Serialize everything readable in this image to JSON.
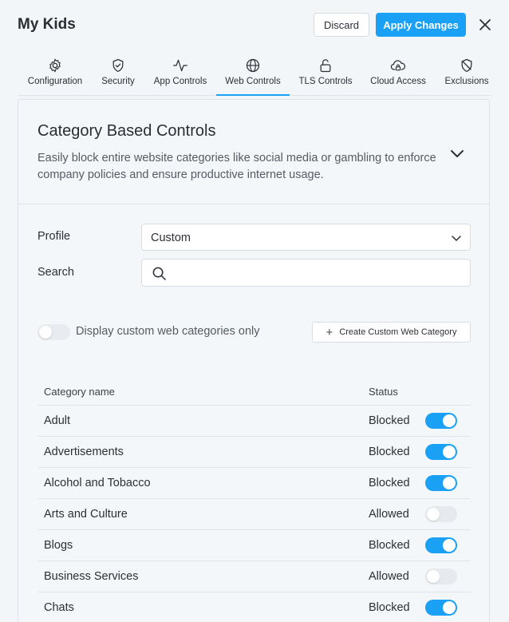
{
  "header": {
    "title": "My Kids",
    "discard_label": "Discard",
    "apply_label": "Apply Changes"
  },
  "tabs": [
    {
      "label": "Configuration",
      "icon": "gear-icon"
    },
    {
      "label": "Security",
      "icon": "shield-check-icon"
    },
    {
      "label": "App Controls",
      "icon": "pulse-icon"
    },
    {
      "label": "Web Controls",
      "icon": "globe-icon",
      "active": true
    },
    {
      "label": "TLS Controls",
      "icon": "unlock-icon"
    },
    {
      "label": "Cloud Access",
      "icon": "cloud-lock-icon"
    },
    {
      "label": "Exclusions",
      "icon": "shield-off-icon"
    }
  ],
  "panel": {
    "title": "Category Based Controls",
    "description": "Easily block entire website categories like social media or gambling to enforce company policies and ensure productive internet usage."
  },
  "form": {
    "profile_label": "Profile",
    "profile_value": "Custom",
    "search_label": "Search",
    "search_placeholder": ""
  },
  "filter": {
    "custom_only_label": "Display custom web categories only",
    "custom_only_on": false,
    "create_label": "Create Custom Web Category"
  },
  "table": {
    "col_name": "Category name",
    "col_status": "Status",
    "rows": [
      {
        "name": "Adult",
        "status": "Blocked",
        "on": true
      },
      {
        "name": "Advertisements",
        "status": "Blocked",
        "on": true
      },
      {
        "name": "Alcohol and Tobacco",
        "status": "Blocked",
        "on": true
      },
      {
        "name": "Arts and Culture",
        "status": "Allowed",
        "on": false
      },
      {
        "name": "Blogs",
        "status": "Blocked",
        "on": true
      },
      {
        "name": "Business Services",
        "status": "Allowed",
        "on": false
      },
      {
        "name": "Chats",
        "status": "Blocked",
        "on": true
      }
    ]
  },
  "colors": {
    "accent": "#1aa1f5",
    "toggle_off": "#e6e9ed",
    "background": "#f3f6f9"
  }
}
